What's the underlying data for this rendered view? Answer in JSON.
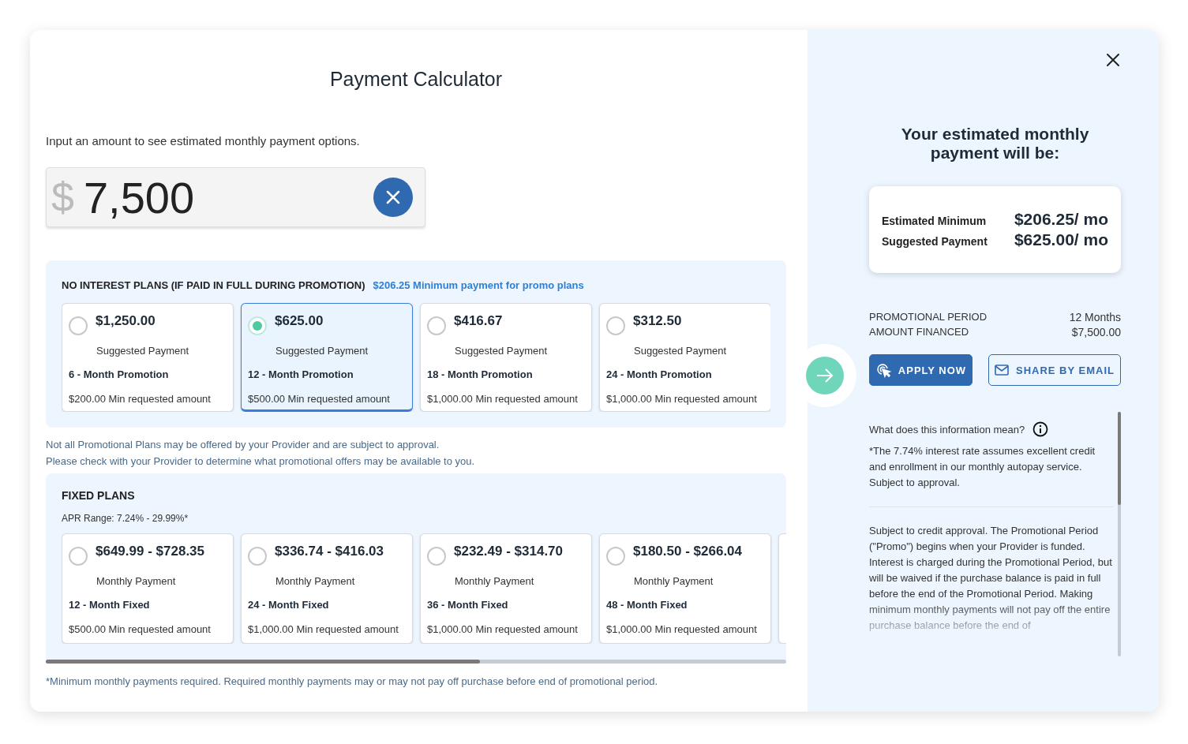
{
  "title": "Payment Calculator",
  "intro": "Input an amount to see estimated monthly payment options.",
  "amount_field": {
    "currency": "$",
    "value": "7,500"
  },
  "promo_plans": {
    "heading": "NO INTEREST PLANS (IF PAID IN FULL DURING PROMOTION)",
    "note": "$206.25 Minimum payment for promo plans",
    "plans": [
      {
        "amount": "$1,250.00",
        "label": "Suggested Payment",
        "term": "6 - Month Promotion",
        "minimum": "$200.00 Min requested amount",
        "selected": false
      },
      {
        "amount": "$625.00",
        "label": "Suggested Payment",
        "term": "12 - Month Promotion",
        "minimum": "$500.00 Min requested amount",
        "selected": true
      },
      {
        "amount": "$416.67",
        "label": "Suggested Payment",
        "term": "18 - Month Promotion",
        "minimum": "$1,000.00 Min requested amount",
        "selected": false
      },
      {
        "amount": "$312.50",
        "label": "Suggested Payment",
        "term": "24 - Month Promotion",
        "minimum": "$1,000.00 Min requested amount",
        "selected": false
      }
    ]
  },
  "disclaimers": [
    "Not all Promotional Plans may be offered by your Provider and are subject to approval.",
    "Please check with your Provider to determine what promotional offers may be available to you."
  ],
  "fixed_plans": {
    "heading": "FIXED PLANS",
    "apr": "APR Range: 7.24% - 29.99%*",
    "plans": [
      {
        "amount": "$649.99 - $728.35",
        "label": "Monthly Payment",
        "term": "12 - Month Fixed",
        "minimum": "$500.00 Min requested amount",
        "selected": false
      },
      {
        "amount": "$336.74 - $416.03",
        "label": "Monthly Payment",
        "term": "24 - Month Fixed",
        "minimum": "$1,000.00 Min requested amount",
        "selected": false
      },
      {
        "amount": "$232.49 - $314.70",
        "label": "Monthly Payment",
        "term": "36 - Month Fixed",
        "minimum": "$1,000.00 Min requested amount",
        "selected": false
      },
      {
        "amount": "$180.50 - $266.04",
        "label": "Monthly Payment",
        "term": "48 - Month Fixed",
        "minimum": "$1,000.00 Min requested amount",
        "selected": false
      }
    ]
  },
  "footnote": "*Minimum monthly payments required. Required monthly payments may or may not pay off purchase before end of promotional period.",
  "summary": {
    "heading": "Your estimated monthly payment will be:",
    "rows": [
      {
        "label": "Estimated Minimum",
        "value": "$206.25/ mo"
      },
      {
        "label": "Suggested Payment",
        "value": "$625.00/ mo"
      }
    ],
    "details": [
      {
        "label": "PROMOTIONAL PERIOD",
        "value": "12 Months"
      },
      {
        "label": "AMOUNT FINANCED",
        "value": "$7,500.00"
      }
    ],
    "buttons": [
      {
        "label": "APPLY NOW",
        "kind": "primary"
      },
      {
        "label": "SHARE BY EMAIL",
        "kind": "outline"
      }
    ],
    "info": {
      "question": "What does this information mean?",
      "note": "*The 7.74% interest rate assumes excellent credit and enrollment in our monthly autopay service. Subject to approval.",
      "paragraph": "Subject to credit approval. The Promotional Period (\"Promo\") begins when your Provider is funded. Interest is charged during the Promotional Period, but will be waived if the purchase balance is paid in full before the end of the Promotional Period. Making minimum monthly payments will not pay off the entire purchase balance before the end of"
    }
  }
}
